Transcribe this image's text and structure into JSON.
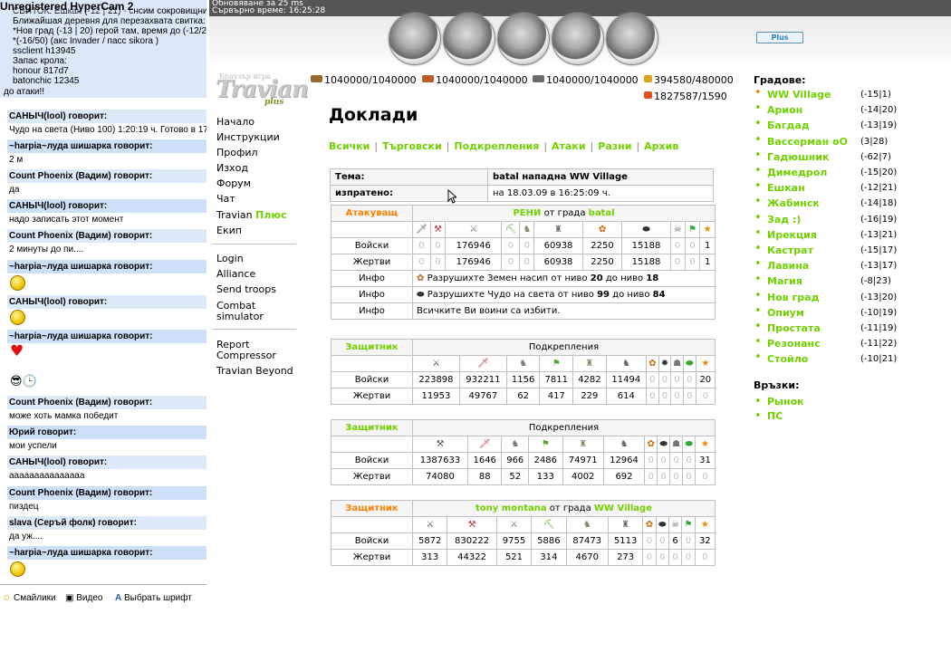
{
  "chat": {
    "window_title": "Unregistered HyperCam 2",
    "top_lines": [
      "СВИТОК: Ешкан (-12 | 21) - снсим сокровищниц",
      "Ближайшая деревня для перезахвата свитка:",
      "*Нов град (-13 | 20) герой там, время до (-12/21",
      "*(-16/50) (акс Invader / пасс sikora )",
      "ssclient h13945",
      "Запас крола:",
      "honour    817d7",
      "batonchic   12345",
      "до атаки!!"
    ],
    "messages": [
      {
        "author": "САНЫЧ(lool) говорит:",
        "text": "Чудо на света (Ниво 100) 1:20:19 ч. Готово в 17:"
      },
      {
        "author": "~harpia~луда шишарка говорит:",
        "text": "2 м"
      },
      {
        "author": "Count Phoenix (Вадим) говорит:",
        "text": "да"
      },
      {
        "author": "САНЫЧ(lool) говорит:",
        "text": "надо записать этот момент"
      },
      {
        "author": "Count Phoenix (Вадим) говорит:",
        "text": "2 минуты до пи...."
      },
      {
        "author": "~harpia~луда шишарка говорит:",
        "text": ""
      },
      {
        "author": "САНЫЧ(lool) говорит:",
        "text": ""
      },
      {
        "author": "~harpia~луда шишарка говорит:",
        "text": ""
      },
      {
        "author": "Count Phoenix (Вадим) говорит:",
        "text": "може хоть мамка победит"
      },
      {
        "author": "Юрий говорит:",
        "text": "мои успели"
      },
      {
        "author": "САНЫЧ(lool) говорит:",
        "text": "ааааааааааааааа"
      },
      {
        "author": "Count Phoenix (Вадим) говорит:",
        "text": "пиздец"
      },
      {
        "author": "slava (Серъй фолк) говорит:",
        "text": "да уж...."
      },
      {
        "author": "~harpia~луда шишарка говорит:",
        "text": ""
      }
    ],
    "bottom": {
      "smileys": "Смайлики",
      "video": "Видео",
      "font": "Выбрать шрифт"
    }
  },
  "banner": {
    "line1": "Обновяване за 25 ms",
    "line2": "Сървърно време: 16:25:28",
    "plus_label": "Plus"
  },
  "logo": {
    "main": "Travian",
    "sub": "plus",
    "tag": "Браузър игра"
  },
  "menu": {
    "items1": [
      "Начало",
      "Инструкции",
      "Профил",
      "Изход",
      "Форум",
      "Чат"
    ],
    "travian_plus_a": "Travian",
    "travian_plus_b": "Плюс",
    "ekip": "Екип",
    "items2": [
      "Login",
      "Alliance",
      "Send troops",
      "Combat",
      "simulator"
    ],
    "items3": [
      "Report",
      "Compressor",
      "Travian Beyond"
    ]
  },
  "resources": {
    "wood": "1040000/1040000",
    "clay": "1040000/1040000",
    "iron": "1040000/1040000",
    "crop": "394580/480000",
    "consumption": "1827587/1590"
  },
  "report": {
    "title": "Доклади",
    "tabs": [
      "Всички",
      "Търговски",
      "Подкрепления",
      "Атаки",
      "Разни",
      "Архив"
    ],
    "subject_label": "Тема:",
    "subject_value": "batal нападна WW Village",
    "sent_label": "изпратено:",
    "sent_value": "на 18.03.09 в 16:25:09 ч.",
    "attacker": {
      "role": "Атакуващ",
      "player": "РЕНИ",
      "from": "от града",
      "village": "batal",
      "troops": [
        "0",
        "0",
        "176946",
        "0",
        "0",
        "60938",
        "2250",
        "15188",
        "0",
        "0",
        "1"
      ],
      "losses": [
        "0",
        "0",
        "176946",
        "0",
        "0",
        "60938",
        "2250",
        "15188",
        "0",
        "0",
        "1"
      ],
      "info1_a": "Разрушихте Земен насип от ниво",
      "info1_b": "20",
      "info1_c": "до ниво",
      "info1_d": "18",
      "info2_a": "Разрушихте Чудо на света от ниво",
      "info2_b": "99",
      "info2_c": "до ниво",
      "info2_d": "84",
      "info3": "Всичките Ви воини са избити."
    },
    "labels": {
      "troops": "Войски",
      "losses": "Жертви",
      "info": "Инфо",
      "defender": "Защитник",
      "reinf": "Подкрепления"
    },
    "def1": {
      "troops": [
        "223898",
        "932211",
        "1156",
        "7811",
        "4282",
        "11494",
        "0",
        "0",
        "0",
        "0",
        "20"
      ],
      "losses": [
        "11953",
        "49767",
        "62",
        "417",
        "229",
        "614",
        "0",
        "0",
        "0",
        "0",
        "0"
      ]
    },
    "def2": {
      "troops": [
        "1387633",
        "1646",
        "966",
        "2486",
        "74971",
        "12964",
        "0",
        "0",
        "0",
        "0",
        "31"
      ],
      "losses": [
        "74080",
        "88",
        "52",
        "133",
        "4002",
        "692",
        "0",
        "0",
        "0",
        "0",
        "0"
      ]
    },
    "def3": {
      "player": "tony montana",
      "from": "от града",
      "village": "WW Village",
      "troops": [
        "5872",
        "830222",
        "9755",
        "5886",
        "87473",
        "5113",
        "0",
        "0",
        "6",
        "0",
        "32"
      ],
      "losses": [
        "313",
        "44322",
        "521",
        "314",
        "4670",
        "273",
        "0",
        "0",
        "0",
        "0",
        "0"
      ]
    }
  },
  "villages": {
    "title": "Градове:",
    "list": [
      {
        "name": "WW Village",
        "coords": "(-15|1)"
      },
      {
        "name": "Арион",
        "coords": "(-14|20)"
      },
      {
        "name": "Багдад",
        "coords": "(-13|19)"
      },
      {
        "name": "Вассерман оО",
        "coords": "(3|28)"
      },
      {
        "name": "Гадюшник",
        "coords": "(-62|7)"
      },
      {
        "name": "Димедрол",
        "coords": "(-15|20)"
      },
      {
        "name": "Ешкан",
        "coords": "(-12|21)"
      },
      {
        "name": "Жабинск",
        "coords": "(-14|18)"
      },
      {
        "name": "Зад :)",
        "coords": "(-16|19)"
      },
      {
        "name": "Ирекция",
        "coords": "(-13|21)"
      },
      {
        "name": "Кастрат",
        "coords": "(-15|17)"
      },
      {
        "name": "Лавина",
        "coords": "(-13|17)"
      },
      {
        "name": "Магия",
        "coords": "(-8|23)"
      },
      {
        "name": "Нов град",
        "coords": "(-13|20)"
      },
      {
        "name": "Опиум",
        "coords": "(-10|19)"
      },
      {
        "name": "Простата",
        "coords": "(-11|19)"
      },
      {
        "name": "Резонанс",
        "coords": "(-11|22)"
      },
      {
        "name": "Стойло",
        "coords": "(-10|21)"
      }
    ],
    "links_title": "Връзки:",
    "links": [
      "Рынок",
      "ПС"
    ]
  }
}
